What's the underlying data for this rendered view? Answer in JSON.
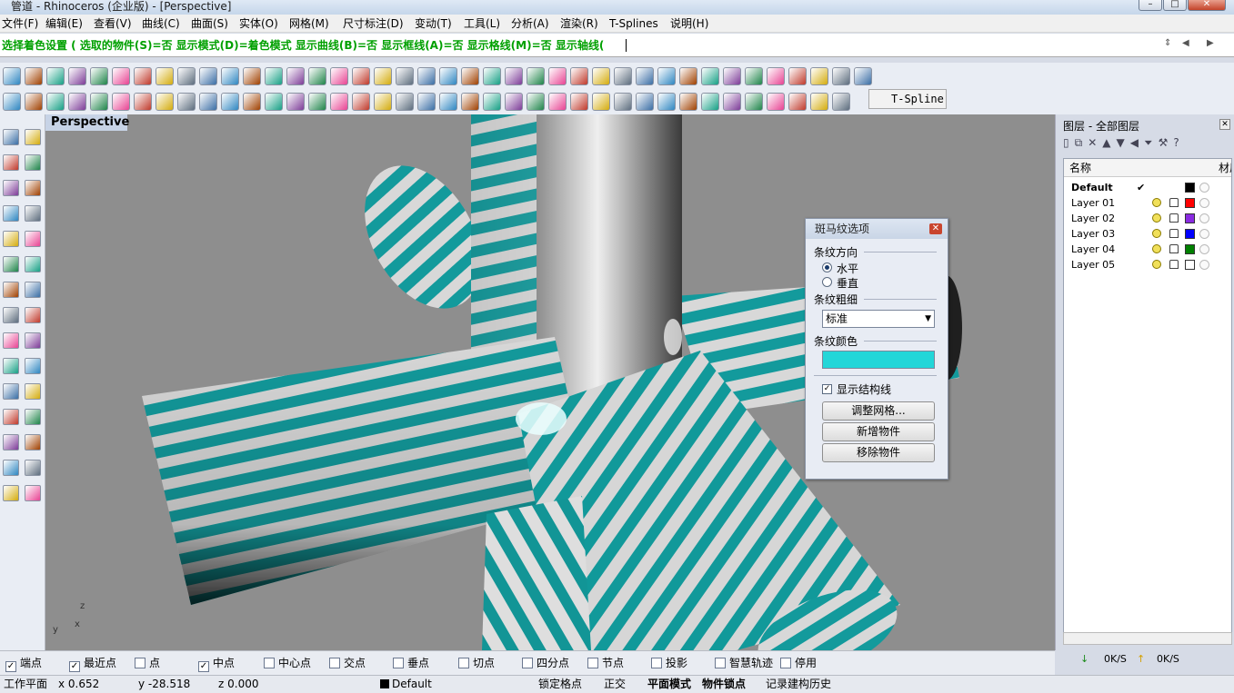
{
  "window": {
    "title": "管道 - Rhinoceros (企业版) - [Perspective]"
  },
  "menu": [
    "文件(F)",
    "编辑(E)",
    "查看(V)",
    "曲线(C)",
    "曲面(S)",
    "实体(O)",
    "网格(M)",
    "尺寸标注(D)",
    "变动(T)",
    "工具(L)",
    "分析(A)",
    "渲染(R)",
    "T-Splines",
    "说明(H)"
  ],
  "command": {
    "text": "选择着色设置 ( 选取的物件(S)=否 显示模式(D)=着色模式 显示曲线(B)=否 显示框线(A)=否 显示格线(M)=否 显示轴线("
  },
  "toolbar": {
    "tsplines_label": "T-Spline"
  },
  "viewport": {
    "tab": "Perspective",
    "axis_z": "z",
    "axis_y": "y",
    "axis_x": "x"
  },
  "dialog": {
    "title": "斑马纹选项",
    "direction_label": "条纹方向",
    "horizontal": "水平",
    "vertical": "垂直",
    "thickness_label": "条纹粗细",
    "thickness_value": "标准",
    "color_label": "条纹颜色",
    "stripe_color": "#22d6d8",
    "show_structure": "显示结构线",
    "adjust_mesh": "调整网格...",
    "add_objects": "新增物件",
    "remove_objects": "移除物件"
  },
  "layers": {
    "header": "图层 - 全部图层",
    "col_name": "名称",
    "col_material": "材质",
    "rows": [
      {
        "name": "Default",
        "color": "#000000",
        "current": true
      },
      {
        "name": "Layer 01",
        "color": "#ff0000"
      },
      {
        "name": "Layer 02",
        "color": "#8a2be2"
      },
      {
        "name": "Layer 03",
        "color": "#0000ff"
      },
      {
        "name": "Layer 04",
        "color": "#008000"
      },
      {
        "name": "Layer 05",
        "color": "#ffffff"
      }
    ],
    "speed_down": "0K/S",
    "speed_up": "0K/S"
  },
  "osnaps": [
    {
      "label": "端点",
      "checked": true
    },
    {
      "label": "最近点",
      "checked": true
    },
    {
      "label": "点",
      "checked": false
    },
    {
      "label": "中点",
      "checked": true
    },
    {
      "label": "中心点",
      "checked": false
    },
    {
      "label": "交点",
      "checked": false
    },
    {
      "label": "垂点",
      "checked": false
    },
    {
      "label": "切点",
      "checked": false
    },
    {
      "label": "四分点",
      "checked": false
    },
    {
      "label": "节点",
      "checked": false
    },
    {
      "label": "投影",
      "checked": false
    },
    {
      "label": "智慧轨迹",
      "checked": false
    },
    {
      "label": "停用",
      "checked": false
    }
  ],
  "status": {
    "cplane": "工作平面",
    "x": "x 0.652",
    "y": "y -28.518",
    "z": "z 0.000",
    "layer": "Default",
    "grid_snap": "锁定格点",
    "ortho": "正交",
    "planar": "平面模式",
    "osnap": "物件锁点",
    "history": "记录建构历史"
  }
}
